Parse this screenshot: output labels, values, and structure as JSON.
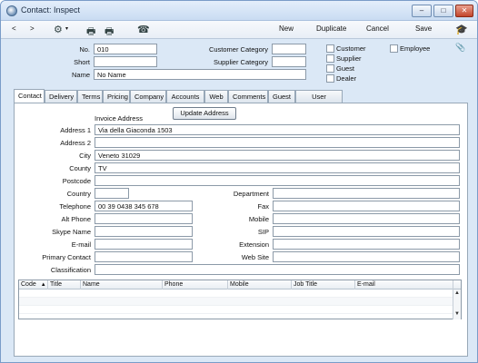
{
  "window": {
    "title": "Contact: Inspect",
    "min": "–",
    "max": "□",
    "close": "✕"
  },
  "toolbar": {
    "back": "<",
    "forward": ">",
    "gear": "⚙",
    "print": "🖶",
    "preview": "🖶",
    "phone": "☎",
    "new": "New",
    "duplicate": "Duplicate",
    "cancel": "Cancel",
    "save": "Save",
    "hat": "🎓"
  },
  "header": {
    "no_label": "No.",
    "no_value": "010",
    "short_label": "Short",
    "short_value": "",
    "name_label": "Name",
    "name_value": "No Name",
    "customer_category_label": "Customer Category",
    "customer_category_value": "",
    "supplier_category_label": "Supplier Category",
    "supplier_category_value": "",
    "checks": {
      "customer": "Customer",
      "supplier": "Supplier",
      "guest": "Guest",
      "dealer": "Dealer",
      "employee": "Employee"
    },
    "clip": "📎"
  },
  "tabs": [
    "Contact",
    "Delivery",
    "Terms",
    "Pricing",
    "Company",
    "Accounts",
    "Web",
    "Comments",
    "Guest",
    "User Defined"
  ],
  "contact": {
    "invoice_address_heading": "Invoice Address",
    "update_address_button": "Update Address",
    "address1_label": "Address 1",
    "address1_value": "Via della Giaconda 1503",
    "address2_label": "Address 2",
    "address2_value": "",
    "city_label": "City",
    "city_value": "Veneto 31029",
    "county_label": "County",
    "county_value": "TV",
    "postcode_label": "Postcode",
    "postcode_value": "",
    "country_label": "Country",
    "country_value": "",
    "telephone_label": "Telephone",
    "telephone_value": "00 39 0438 345 678",
    "alt_phone_label": "Alt Phone",
    "alt_phone_value": "",
    "skype_label": "Skype Name",
    "skype_value": "",
    "email_label": "E-mail",
    "email_value": "",
    "primary_contact_label": "Primary Contact",
    "primary_contact_value": "",
    "classification_label": "Classification",
    "classification_value": "",
    "department_label": "Department",
    "department_value": "",
    "fax_label": "Fax",
    "fax_value": "",
    "mobile_label": "Mobile",
    "mobile_value": "",
    "sip_label": "SIP",
    "sip_value": "",
    "extension_label": "Extension",
    "extension_value": "",
    "website_label": "Web Site",
    "website_value": ""
  },
  "grid": {
    "columns": [
      "Code",
      "Title",
      "Name",
      "Phone",
      "Mobile",
      "Job Title",
      "E-mail"
    ],
    "sort_indicator": "▲",
    "scroll_up": "▲",
    "scroll_down": "▼"
  }
}
